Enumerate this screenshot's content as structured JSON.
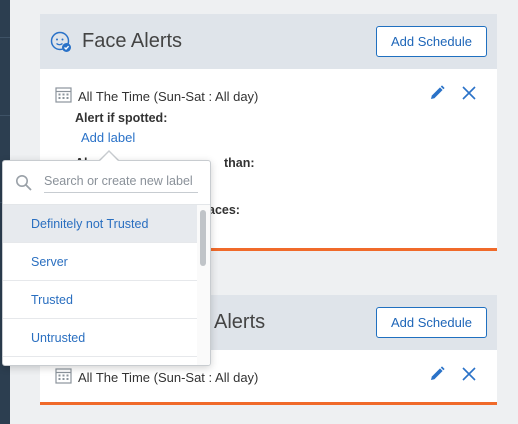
{
  "face_alerts": {
    "title": "Face Alerts",
    "add_schedule": "Add Schedule",
    "schedule_text": "All The Time (Sun-Sat : All day)",
    "alert_if_spotted": "Alert if spotted:",
    "add_label": "Add label",
    "partial_line_1": "Al",
    "partial_line_1b": "than:",
    "partial_line_2": "aces:"
  },
  "second_card": {
    "title_partial": "Alerts",
    "add_schedule": "Add Schedule",
    "schedule_text": "All The Time (Sun-Sat : All day)"
  },
  "label_dropdown": {
    "search_placeholder": "Search or create new label",
    "items": [
      "Definitely not Trusted",
      "Server",
      "Trusted",
      "Untrusted"
    ],
    "selected_index": 0
  },
  "colors": {
    "accent_blue": "#1e66b8",
    "accent_orange": "#f06a2a",
    "sidebar": "#2c3e50"
  }
}
